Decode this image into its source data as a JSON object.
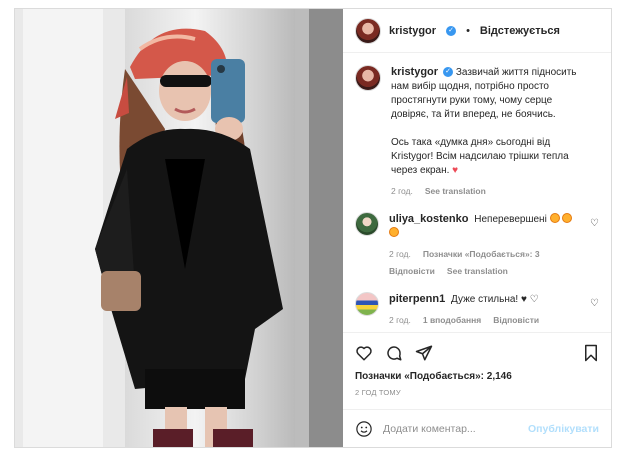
{
  "post": {
    "author": "kristygor",
    "follow_status": "Відстежується",
    "separator": "•"
  },
  "caption": {
    "username": "kristygor",
    "text_part1": "Зазвичай життя підносить нам вибір щодня, потрібно просто простягнути руки тому, чому серце довіряє, та йти вперед, не боячись.",
    "text_part2": "Ось така «думка дня» сьогодні від Kristygor! Всім надсилаю трішки тепла через екран.",
    "time": "2 год.",
    "see_translation": "See translation"
  },
  "comments": [
    {
      "username": "uliya_kostenko",
      "text": "Неперевершені",
      "time": "2 год.",
      "likes": "Позначки «Подобається»: 3",
      "reply": "Відповісти",
      "see_translation": "See translation"
    },
    {
      "username": "piterpenn1",
      "text": "Дуже стильна!",
      "time": "2 год.",
      "likes": "1 вподобання",
      "reply": "Відповісти"
    }
  ],
  "actions": {
    "likes_count": "Позначки «Подобається»: 2,146",
    "posted_time": "2 ГОД ТОМУ"
  },
  "add_comment": {
    "placeholder": "Додати коментар...",
    "publish": "Опублікувати"
  },
  "icons": [
    "verified-badge-icon",
    "heart-icon",
    "comment-icon",
    "share-icon",
    "bookmark-icon",
    "emoji-icon"
  ],
  "colors": {
    "verified": "#3897f0",
    "publish": "#b2dffc",
    "heart": "#ed4956"
  }
}
